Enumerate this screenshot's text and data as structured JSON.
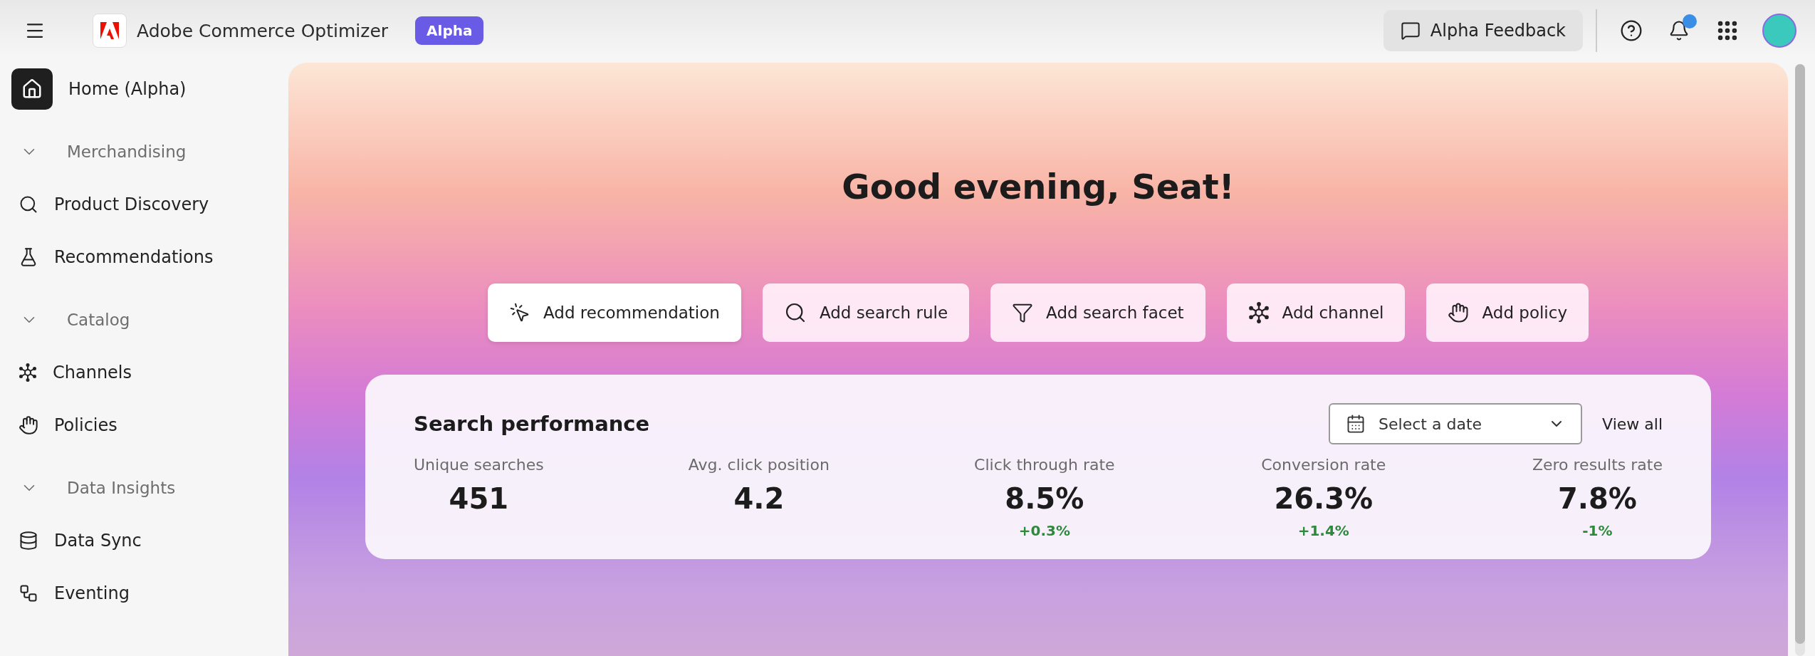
{
  "header": {
    "product_name": "Adobe Commerce Optimizer",
    "badge": "Alpha",
    "feedback_button": "Alpha Feedback",
    "notification": true
  },
  "sidebar": {
    "items": [
      {
        "kind": "link",
        "label": "Home (Alpha)",
        "selected": true
      },
      {
        "kind": "section",
        "label": "Merchandising",
        "expanded": true
      },
      {
        "kind": "link",
        "label": "Product Discovery",
        "selected": false
      },
      {
        "kind": "link",
        "label": "Recommendations",
        "selected": false
      },
      {
        "kind": "section",
        "label": "Catalog",
        "expanded": true
      },
      {
        "kind": "link",
        "label": "Channels",
        "selected": false
      },
      {
        "kind": "link",
        "label": "Policies",
        "selected": false
      },
      {
        "kind": "section",
        "label": "Data Insights",
        "expanded": true
      },
      {
        "kind": "link",
        "label": "Data Sync",
        "selected": false
      },
      {
        "kind": "link",
        "label": "Eventing",
        "selected": false
      }
    ]
  },
  "greeting": "Good evening, Seat!",
  "quick_actions": [
    {
      "label": "Add recommendation",
      "hovered": true
    },
    {
      "label": "Add search rule",
      "hovered": false
    },
    {
      "label": "Add search facet",
      "hovered": false
    },
    {
      "label": "Add channel",
      "hovered": false
    },
    {
      "label": "Add policy",
      "hovered": false
    }
  ],
  "search_performance": {
    "title": "Search performance",
    "date_picker": {
      "placeholder": "Select a date"
    },
    "view_all": "View all",
    "metrics": [
      {
        "label": "Unique searches",
        "value": "451"
      },
      {
        "label": "Avg. click position",
        "value": "4.2"
      },
      {
        "label": "Click through rate",
        "value": "8.5%",
        "delta": "+0.3%"
      },
      {
        "label": "Conversion rate",
        "value": "26.3%",
        "delta": "+1.4%"
      },
      {
        "label": "Zero results rate",
        "value": "7.8%",
        "delta": "-1%"
      }
    ]
  }
}
